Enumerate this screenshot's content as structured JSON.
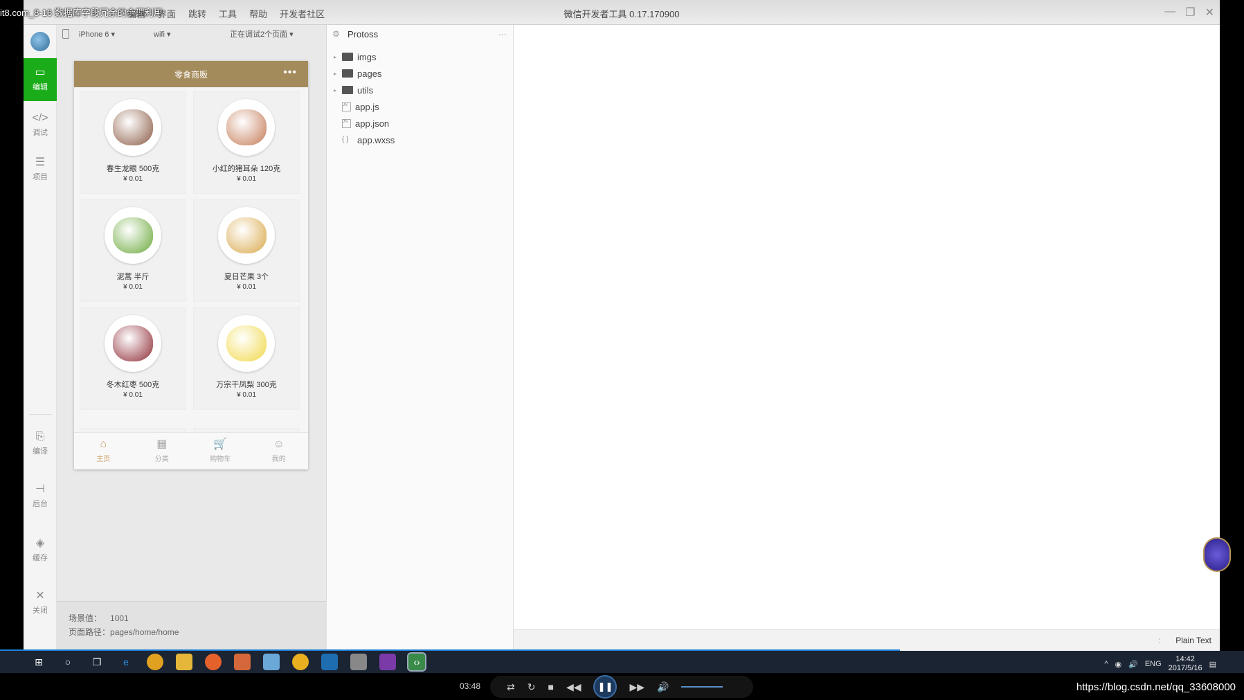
{
  "video_title": "it8.com_8-16 数据库字段冗余的合理利用",
  "window": {
    "title": "微信开发者工具 0.17.170900",
    "menu": [
      "编辑",
      "界面",
      "跳转",
      "工具",
      "帮助",
      "开发者社区"
    ],
    "controls": [
      "—",
      "❐",
      "✕"
    ]
  },
  "activity": {
    "items": [
      {
        "label": "编辑",
        "icon": "editor-icon",
        "glyph": "▭",
        "active": true
      },
      {
        "label": "调试",
        "icon": "code-icon",
        "glyph": "</>",
        "active": false
      },
      {
        "label": "项目",
        "icon": "menu-icon",
        "glyph": "☰",
        "active": false
      },
      {
        "label": "编译",
        "icon": "compile-icon",
        "glyph": "⎘",
        "active": false
      },
      {
        "label": "后台",
        "icon": "background-icon",
        "glyph": "⊣",
        "active": false
      },
      {
        "label": "缓存",
        "icon": "layers-icon",
        "glyph": "◈",
        "active": false
      },
      {
        "label": "关闭",
        "icon": "close-icon",
        "glyph": "✕",
        "active": false
      }
    ]
  },
  "simulator": {
    "device": "iPhone 6",
    "network": "wifi",
    "debug_pages": "正在调试2个页面",
    "app_title": "零食商贩",
    "products": [
      {
        "name": "春生龙眼 500克",
        "price": "¥ 0.01",
        "color": "#8a5a44"
      },
      {
        "name": "小红的猪耳朵 120克",
        "price": "¥ 0.01",
        "color": "#c47a56"
      },
      {
        "name": "泥蒿 半斤",
        "price": "¥ 0.01",
        "color": "#6aa83a"
      },
      {
        "name": "夏日芒果 3个",
        "price": "¥ 0.01",
        "color": "#d9a84a"
      },
      {
        "name": "冬木红枣 500克",
        "price": "¥ 0.01",
        "color": "#8e2a35"
      },
      {
        "name": "万宗干凤梨 300克",
        "price": "¥ 0.01",
        "color": "#f0d847"
      }
    ],
    "tabs": [
      {
        "label": "主页",
        "icon": "home-icon",
        "glyph": "⌂",
        "active": true
      },
      {
        "label": "分类",
        "icon": "grid-icon",
        "glyph": "▦",
        "active": false
      },
      {
        "label": "购物车",
        "icon": "cart-icon",
        "glyph": "🛒",
        "active": false
      },
      {
        "label": "我的",
        "icon": "user-icon",
        "glyph": "☺",
        "active": false
      }
    ],
    "scene_label": "场景值：",
    "scene_value": "1001",
    "path_label": "页面路径：",
    "path_value": "pages/home/home"
  },
  "filetree": {
    "project": "Protoss",
    "more": "···",
    "items": [
      {
        "name": "imgs",
        "type": "folder"
      },
      {
        "name": "pages",
        "type": "folder"
      },
      {
        "name": "utils",
        "type": "folder"
      },
      {
        "name": "app.js",
        "type": "js"
      },
      {
        "name": "app.json",
        "type": "json"
      },
      {
        "name": "app.wxss",
        "type": "wxss"
      }
    ]
  },
  "editor": {
    "language": "Plain Text",
    "separator": ":"
  },
  "taskbar": {
    "lang": "ENG",
    "time": "14:42",
    "date": "2017/5/16"
  },
  "player": {
    "time": "03:48",
    "url": "https://blog.csdn.net/qq_33608000"
  }
}
